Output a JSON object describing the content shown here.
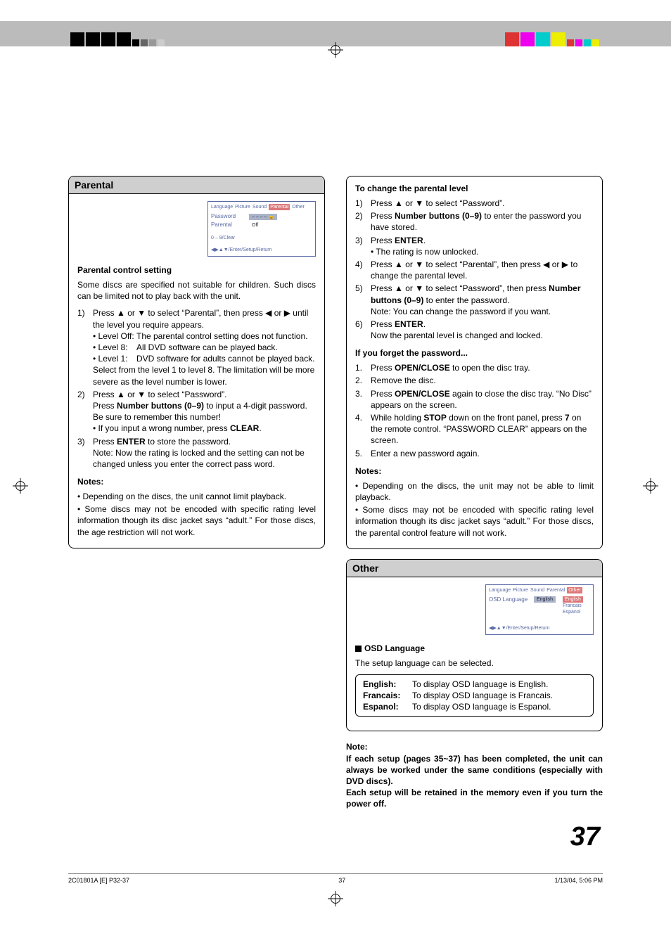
{
  "top": {},
  "parental_panel": {
    "title": "Parental",
    "osd": {
      "tabs": [
        "Language",
        "Picture",
        "Sound",
        "Parental",
        "Other"
      ],
      "selected_tab_index": 3,
      "rows": [
        {
          "label": "Password",
          "value": "– – – – 🔒"
        },
        {
          "label": "Parental",
          "value": "Off"
        }
      ],
      "hint1": "0 – 9/Clear",
      "hint2": "◀▶▲▼/Enter/Setup/Return"
    },
    "h_setting": "Parental control setting",
    "intro": "Some discs are specified not suitable for children. Such discs can be limited not to play back with the unit.",
    "steps": [
      {
        "n": "1)",
        "text_pre": "Press ▲ or ▼ to select “Parental”, then press ◀ or ▶ until the level you require appears.",
        "levels": [
          {
            "k": "• Level Off:",
            "v": "The parental control setting does not function."
          },
          {
            "k": "• Level 8:",
            "v": "All DVD software can be played back."
          },
          {
            "k": "• Level 1:",
            "v": "DVD software for adults cannot be played back."
          }
        ],
        "tail": "Select from the level 1 to level 8. The limitation will be more severe as the level number is lower."
      },
      {
        "n": "2)",
        "text": "Press ▲ or ▼ to select “Password”.\nPress <b>Number buttons (0–9)</b> to input a 4-digit password. Be sure to remember this number!\n• If you input a wrong number, press <b>CLEAR</b>."
      },
      {
        "n": "3)",
        "text": "Press <b>ENTER</b> to store the password.\nNote: Now the rating is locked and the setting can not be changed unless you enter the correct pass word."
      }
    ],
    "notes_h": "Notes:",
    "notes": [
      "Depending on the discs, the unit cannot limit playback.",
      "Some discs may not be encoded with specific rating level information though its disc jacket says “adult.” For those discs, the age restriction will not work."
    ]
  },
  "right_top": {
    "h_change": "To change the parental level",
    "steps": [
      {
        "n": "1)",
        "text": "Press ▲ or ▼ to select “Password”."
      },
      {
        "n": "2)",
        "text": "Press <b>Number buttons (0–9)</b> to enter the password you have stored."
      },
      {
        "n": "3)",
        "text": "Press <b>ENTER</b>.\n• The rating is now unlocked."
      },
      {
        "n": "4)",
        "text": "Press ▲ or ▼ to select “Parental”, then press ◀ or ▶ to change the parental level."
      },
      {
        "n": "5)",
        "text": "Press ▲ or ▼ to select “Password”, then press <b>Number buttons (0–9)</b> to enter the password.\nNote: You can change the password if you want."
      },
      {
        "n": "6)",
        "text": "Press <b>ENTER</b>.\nNow the parental level is changed and locked."
      }
    ],
    "h_forget": "If you forget the password...",
    "forget": [
      {
        "n": "1.",
        "text": "Press <b>OPEN/CLOSE</b> to open the disc tray."
      },
      {
        "n": "2.",
        "text": "Remove the disc."
      },
      {
        "n": "3.",
        "text": "Press <b>OPEN/CLOSE</b> again to close the disc tray. “No Disc” appears on the screen."
      },
      {
        "n": "4.",
        "text": "While holding <b>STOP</b> down on the front panel, press <b>7</b> on the remote control. “PASSWORD CLEAR” appears on the screen."
      },
      {
        "n": "5.",
        "text": "Enter a new password again."
      }
    ],
    "notes_h": "Notes:",
    "notes": [
      "Depending on the discs, the unit may not be able to limit playback.",
      "Some discs may not be encoded with specific rating level information though its disc jacket says “adult.” For those discs, the parental control feature will not work."
    ]
  },
  "other_panel": {
    "title": "Other",
    "osd": {
      "tabs": [
        "Language",
        "Picture",
        "Sound",
        "Parental",
        "Other"
      ],
      "selected_tab_index": 4,
      "label": "OSD Language",
      "selected": "English",
      "options": [
        "English",
        "Francais",
        "Espanol"
      ],
      "hint": "◀▶▲▼/Enter/Setup/Return"
    },
    "sub_h": "OSD Language",
    "intro": "The setup language can be selected.",
    "langs": [
      {
        "k": "English:",
        "v": "To display OSD language is English."
      },
      {
        "k": "Francais:",
        "v": "To display OSD language is Francais."
      },
      {
        "k": "Espanol:",
        "v": "To display OSD language is Espanol."
      }
    ]
  },
  "bottom_note": {
    "h": "Note:",
    "lines": [
      "If each setup (pages 35~37) has been completed, the unit can always be worked under the same conditions (especially with DVD discs).",
      "Each setup will be retained in the memory even if you turn the power off."
    ]
  },
  "pagenum": "37",
  "footer": {
    "left": "2C01801A [E] P32-37",
    "center": "37",
    "right": "1/13/04, 5:06 PM"
  }
}
